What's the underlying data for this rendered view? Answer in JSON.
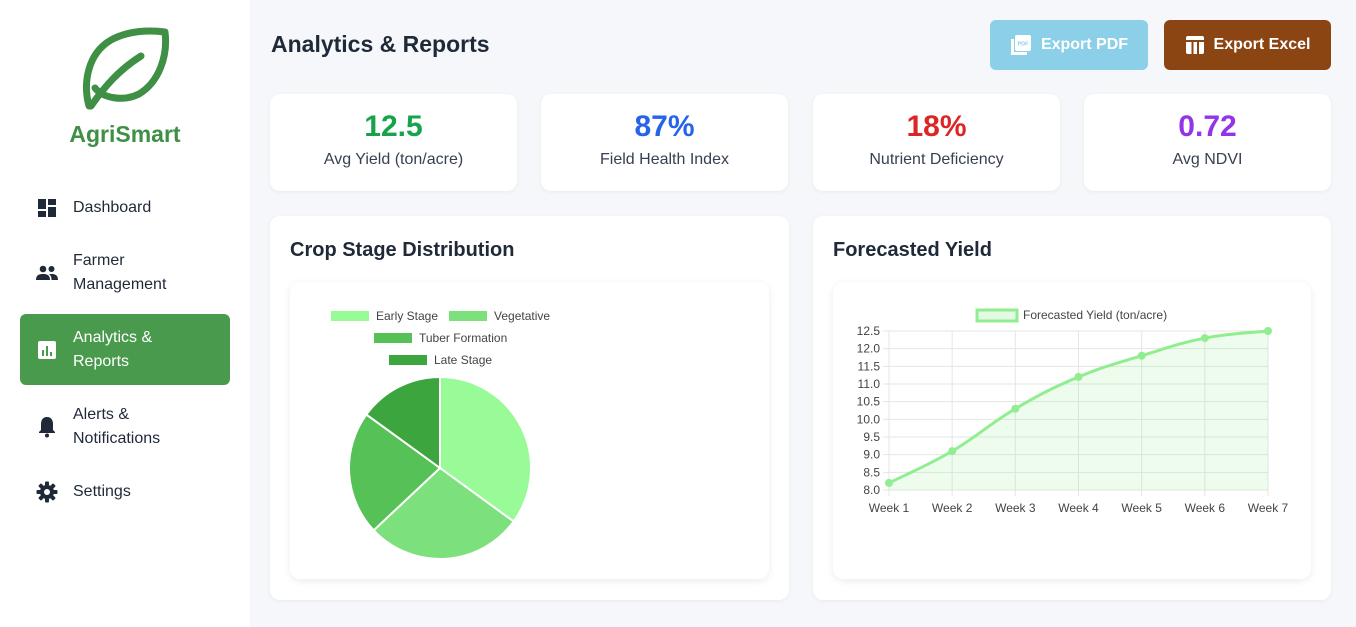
{
  "sidebar": {
    "brand": "AgriSmart",
    "items": [
      {
        "label": "Dashboard",
        "icon": "dashboard-icon"
      },
      {
        "label": "Farmer Management",
        "icon": "people-icon"
      },
      {
        "label": "Analytics & Reports",
        "icon": "chart-icon",
        "active": true
      },
      {
        "label": "Alerts & Notifications",
        "icon": "bell-icon"
      },
      {
        "label": "Settings",
        "icon": "gear-icon"
      }
    ]
  },
  "header": {
    "title": "Analytics & Reports",
    "export_pdf": "Export PDF",
    "export_excel": "Export Excel"
  },
  "kpis": [
    {
      "value": "12.5",
      "label": "Avg Yield (ton/acre)",
      "color": "#16a34a"
    },
    {
      "value": "87%",
      "label": "Field Health Index",
      "color": "#2563eb"
    },
    {
      "value": "18%",
      "label": "Nutrient Deficiency",
      "color": "#dc2626"
    },
    {
      "value": "0.72",
      "label": "Avg NDVI",
      "color": "#9333ea"
    }
  ],
  "colors": {
    "brand": "#3f8f45",
    "active_nav": "#4a9a4e",
    "export_pdf": "#8ccfe8",
    "export_excel": "#8b4513"
  },
  "crop_stage_card": {
    "title": "Crop Stage Distribution"
  },
  "forecast_card": {
    "title": "Forecasted Yield"
  },
  "chart_data": [
    {
      "type": "pie",
      "title": "Crop Stage Distribution",
      "categories": [
        "Early Stage",
        "Vegetative",
        "Tuber Formation",
        "Late Stage"
      ],
      "values": [
        35,
        28,
        22,
        15
      ],
      "colors": [
        "#98fb98",
        "#7ce07c",
        "#56c156",
        "#3da53d"
      ],
      "legend": "top"
    },
    {
      "type": "line",
      "title": "Forecasted Yield",
      "categories": [
        "Week 1",
        "Week 2",
        "Week 3",
        "Week 4",
        "Week 5",
        "Week 6",
        "Week 7"
      ],
      "series": [
        {
          "name": "Forecasted Yield (ton/acre)",
          "values": [
            8.2,
            9.1,
            10.3,
            11.2,
            11.8,
            12.3,
            12.5
          ]
        }
      ],
      "ylim": [
        8.0,
        12.5
      ],
      "yticks": [
        "8.0",
        "8.5",
        "9.0",
        "9.5",
        "10.0",
        "10.5",
        "11.0",
        "11.5",
        "12.0",
        "12.5"
      ],
      "color": "#90ee90",
      "fill": true,
      "grid": true,
      "legend": "top"
    }
  ]
}
